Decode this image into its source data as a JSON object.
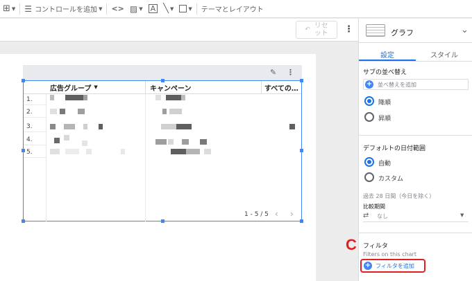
{
  "toolbar": {
    "control_label": "コントロールを追加",
    "theme_label": "テーマとレイアウト"
  },
  "bar2": {
    "reset_label": "リセ\nット"
  },
  "table": {
    "columns": [
      "広告グループ",
      "キャンペーン",
      "すべての…"
    ],
    "row_numbers": [
      "1.",
      "2.",
      "3.",
      "4.",
      "5."
    ],
    "pager_text": "1 - 5 / 5"
  },
  "panel": {
    "chart_type_label": "グラフ",
    "tab_setup": "設定",
    "tab_style": "スタイル",
    "sort_title": "サブの並べ替え",
    "sort_add_label": "並べ替えを追加",
    "order_desc": "降順",
    "order_asc": "昇順",
    "date_title": "デフォルトの日付範囲",
    "date_auto": "自動",
    "date_custom": "カスタム",
    "date_hint": "過去 28 日間（今日を除く）",
    "compare_title": "比較期間",
    "compare_value": "なし",
    "filter_title": "フィルタ",
    "filter_sub": "Filters on this chart",
    "filter_add_label": "フィルタを追加"
  },
  "annotation_letter": "C",
  "colors": {
    "accent": "#1a73e8",
    "annotation": "#e02020"
  }
}
